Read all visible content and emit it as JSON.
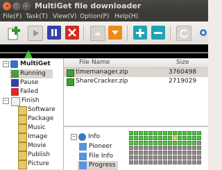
{
  "window": {
    "title": "MultiGet file downloader",
    "close_glyph": "×",
    "min_glyph": "−",
    "max_glyph": "□"
  },
  "menu": [
    "File(F)",
    "Task(T)",
    "View(V)",
    "Option(P)",
    "Help(H)"
  ],
  "toolbar": [
    {
      "name": "new-task-icon",
      "color": "#2f9a2b"
    },
    {
      "name": "start-icon",
      "color": "#9a9a9a"
    },
    {
      "name": "pause-icon",
      "color": "#3540a8"
    },
    {
      "name": "delete-icon",
      "color": "#d12b26"
    },
    {
      "name": "move-up-icon",
      "color": "#c0bdb8"
    },
    {
      "name": "move-down-icon",
      "color": "#f08a16"
    },
    {
      "name": "add-thread-icon",
      "color": "#1fa3b5"
    },
    {
      "name": "remove-thread-icon",
      "color": "#1fa3b5"
    },
    {
      "name": "reload-icon",
      "color": "#bcb8b1"
    },
    {
      "name": "settings-icon",
      "color": "#3a7bc8"
    }
  ],
  "tree": {
    "root": "MultiGet",
    "items": [
      "Running",
      "Pause",
      "Failed",
      "Finish"
    ],
    "finish_children": [
      "Software",
      "Package",
      "Music",
      "Image",
      "Movie",
      "Publish",
      "Picture"
    ]
  },
  "file_list": {
    "columns": [
      "File Name",
      "Size"
    ],
    "rows": [
      {
        "name": "timemanager.zip",
        "size": "3760498"
      },
      {
        "name": "ShareCracker.zip",
        "size": "2719029"
      }
    ]
  },
  "info_tree": {
    "root": "Info",
    "items": [
      "Pioneer",
      "File Info",
      "Progress"
    ]
  },
  "colors": {
    "accent": "#55c14a",
    "title_bar": "#3c3b37"
  }
}
